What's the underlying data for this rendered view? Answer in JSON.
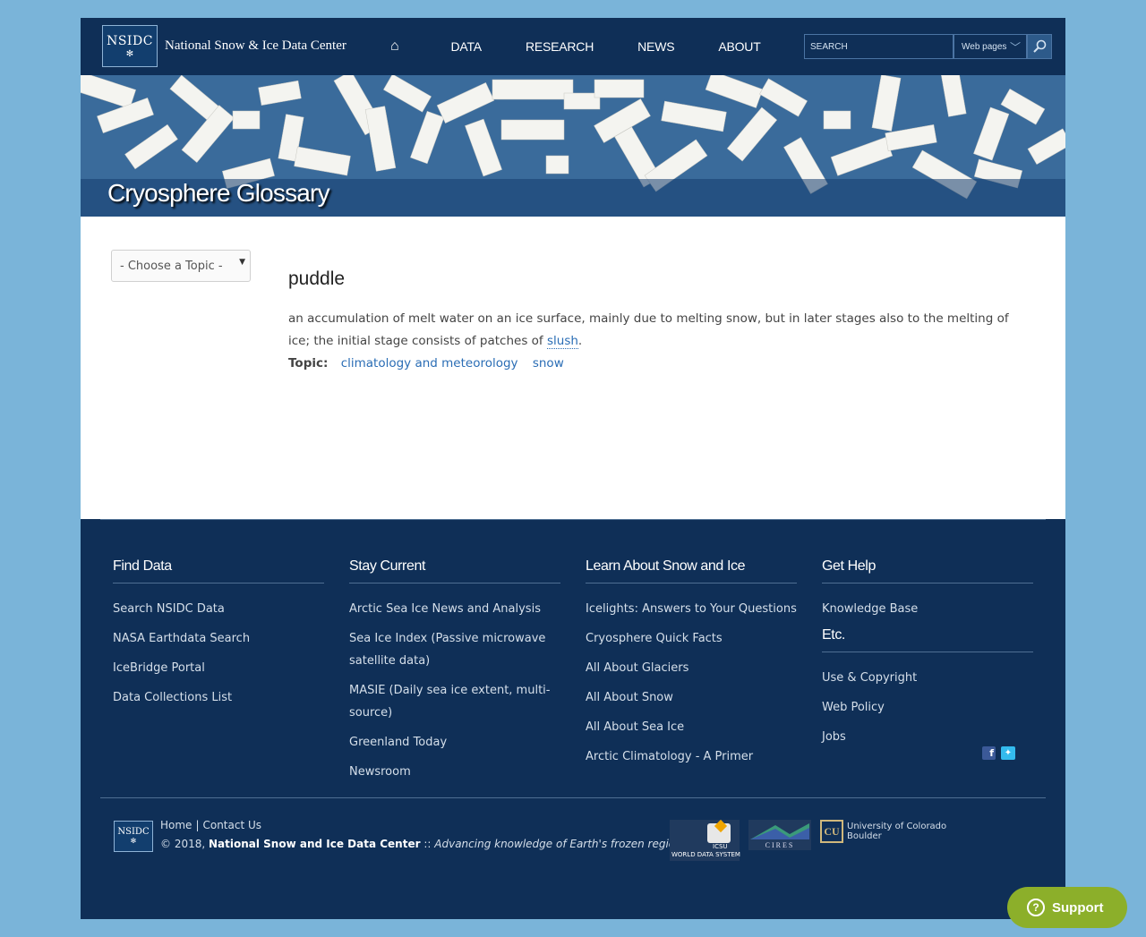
{
  "header": {
    "logo_text": "NSIDC",
    "site_name": "National Snow & Ice Data Center",
    "nav": [
      "DATA",
      "RESEARCH",
      "NEWS",
      "ABOUT"
    ],
    "search_placeholder": "SEARCH",
    "search_scope": "Web pages",
    "home_icon": "home-icon",
    "search_icon": "magnifier-icon"
  },
  "banner": {
    "title": "Cryosphere Glossary"
  },
  "content": {
    "topic_select": "- Choose a Topic -",
    "term": "puddle",
    "definition_before": "an accumulation of melt water on an ice surface, mainly due to melting snow, but in later stages also to the melting of ice; the initial stage consists of patches of ",
    "definition_link": "slush",
    "definition_after": ".",
    "topic_label": "Topic:",
    "topics": [
      "climatology and meteorology",
      "snow"
    ]
  },
  "footer": {
    "columns": [
      {
        "title": "Find Data",
        "links": [
          "Search NSIDC Data",
          "NASA Earthdata Search",
          "IceBridge Portal",
          "Data Collections List"
        ]
      },
      {
        "title": "Stay Current",
        "links": [
          "Arctic Sea Ice News and Analysis",
          "Sea Ice Index (Passive microwave satellite data)",
          "MASIE (Daily sea ice extent, multi-source)",
          "Greenland Today",
          "Newsroom"
        ]
      },
      {
        "title": "Learn About Snow and Ice",
        "links": [
          "Icelights: Answers to Your Questions",
          "Cryosphere Quick Facts",
          "All About Glaciers",
          "All About Snow",
          "All About Sea Ice",
          "Arctic Climatology - A Primer"
        ]
      },
      {
        "title": "Get Help",
        "links": [
          "Knowledge Base"
        ]
      },
      {
        "title": "Etc.",
        "links": [
          "Use & Copyright",
          "Web Policy",
          "Jobs"
        ]
      }
    ],
    "bottom_links": [
      "Home",
      "Contact Us"
    ],
    "copyright": "© 2018,",
    "org_name": "National Snow and Ice Data Center",
    "separator": "::",
    "tagline": "Advancing knowledge of Earth's frozen regions",
    "partners": [
      "ICSU",
      "WORLD DATA SYSTEM",
      "CIRES",
      "University of Colorado",
      "Boulder"
    ]
  },
  "support_button": "Support",
  "colors": {
    "page_bg": "#7ab4d9",
    "header_bg": "#0f2f57",
    "link": "#2a6db5",
    "support": "#8caf2a"
  }
}
